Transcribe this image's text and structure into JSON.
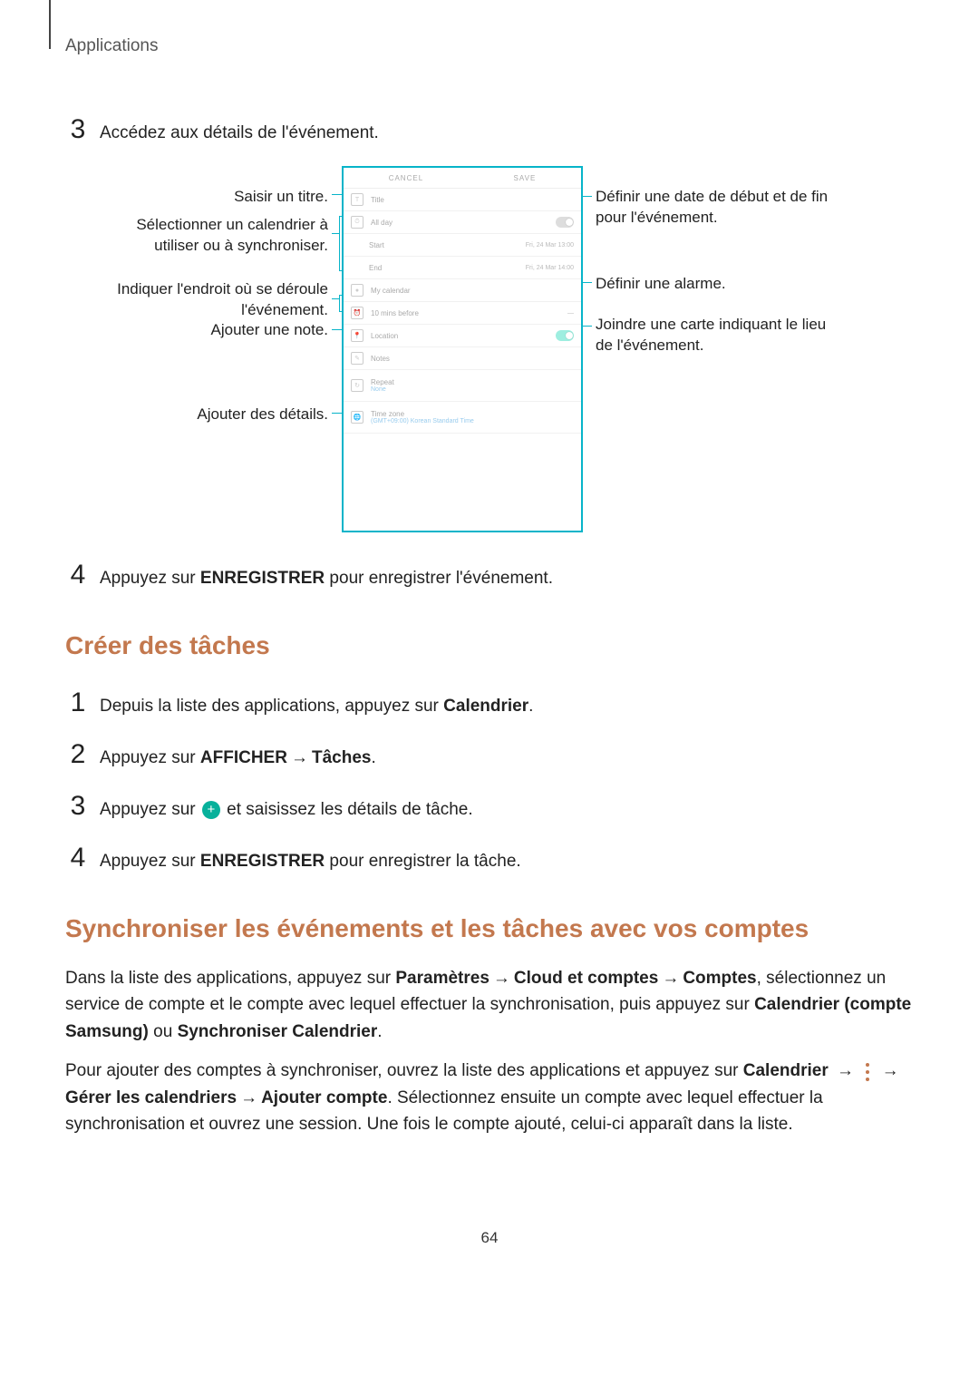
{
  "header": {
    "section": "Applications"
  },
  "step3": {
    "text": "Accédez aux détails de l'événement."
  },
  "callouts": {
    "l1": "Saisir un titre.",
    "l2": "Sélectionner un calendrier à utiliser ou à synchroniser.",
    "l3": "Indiquer l'endroit où se déroule l'événement.",
    "l4": "Ajouter une note.",
    "l5": "Ajouter des détails.",
    "r1": "Définir une date de début et de fin pour l'événement.",
    "r2": "Définir une alarme.",
    "r3": "Joindre une carte indiquant le lieu de l'événement."
  },
  "figure_ui": {
    "cancel": "CANCEL",
    "save": "SAVE",
    "title": "Title",
    "allday": "All day",
    "start": "Start",
    "start_val": "Fri, 24 Mar  13:00",
    "end": "End",
    "end_val": "Fri, 24 Mar  14:00",
    "calendar": "My calendar",
    "reminder": "10 mins before",
    "location": "Location",
    "notes": "Notes",
    "repeat": "Repeat",
    "repeat_sub": "None",
    "timezone": "Time zone",
    "tz_sub": "(GMT+09:00) Korean Standard Time"
  },
  "step4": {
    "pre": "Appuyez sur ",
    "bold": "ENREGISTRER",
    "post": " pour enregistrer l'événement."
  },
  "h_tasks": "Créer des tâches",
  "tasks": {
    "s1a": "Depuis la liste des applications, appuyez sur ",
    "s1b": "Calendrier",
    "s2a": "Appuyez sur ",
    "s2b": "AFFICHER",
    "s2c": "Tâches",
    "s3a": "Appuyez sur ",
    "s3b": " et saisissez les détails de tâche.",
    "s4a": "Appuyez sur ",
    "s4b": "ENREGISTRER",
    "s4c": " pour enregistrer la tâche."
  },
  "h_sync": "Synchroniser les événements et les tâches avec vos comptes",
  "sync_p1": {
    "a": "Dans la liste des applications, appuyez sur ",
    "b1": "Paramètres",
    "b2": "Cloud et comptes",
    "b3": "Comptes",
    "c": ", sélectionnez un service de compte et le compte avec lequel effectuer la synchronisation, puis appuyez sur ",
    "d": "Calendrier (compte Samsung)",
    "e": " ou ",
    "f": "Synchroniser Calendrier",
    "g": "."
  },
  "sync_p2": {
    "a": "Pour ajouter des comptes à synchroniser, ouvrez la liste des applications et appuyez sur ",
    "b": "Calendrier",
    "c1": "Gérer les calendriers",
    "c2": "Ajouter compte",
    "d": ". Sélectionnez ensuite un compte avec lequel effectuer la synchronisation et ouvrez une session. Une fois le compte ajouté, celui-ci apparaît dans la liste."
  },
  "page_number": "64"
}
